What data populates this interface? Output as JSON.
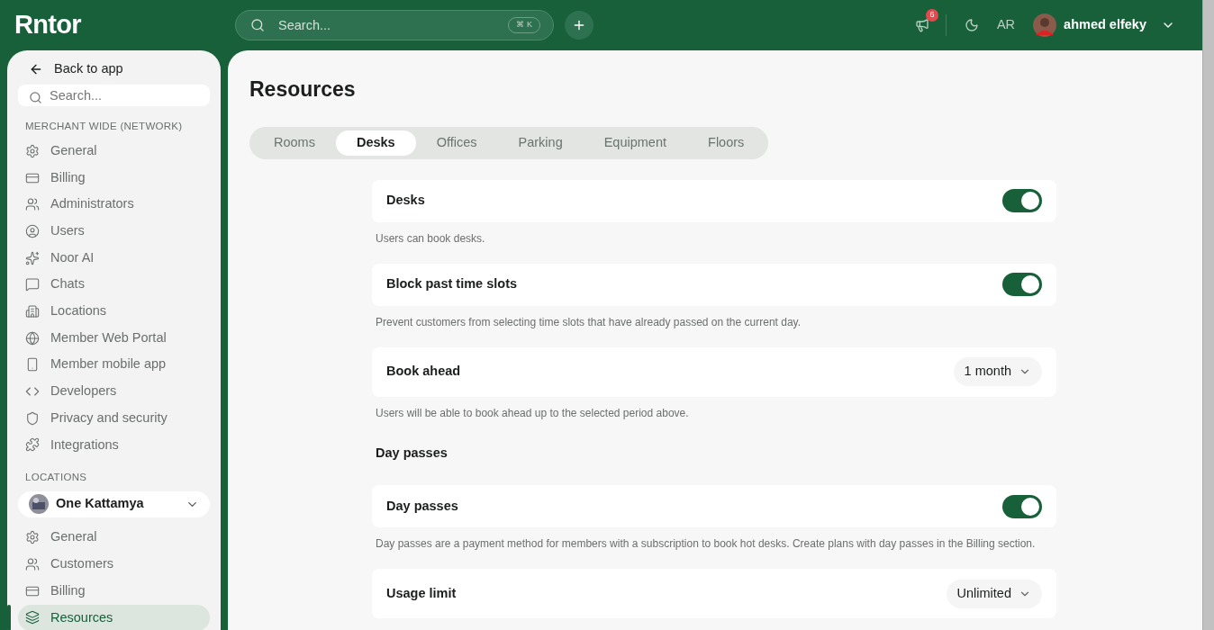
{
  "header": {
    "logo": "Rntor",
    "search": {
      "placeholder": "Search...",
      "shortcut": "⌘ K"
    },
    "notifications": "6",
    "language": "AR",
    "user": "ahmed elfeky"
  },
  "sidebar": {
    "back": "Back to app",
    "search": {
      "placeholder": "Search..."
    },
    "sections": [
      {
        "title": "MERCHANT WIDE (NETWORK)",
        "items": [
          {
            "label": "General",
            "selected": false
          },
          {
            "label": "Billing",
            "selected": false
          },
          {
            "label": "Administrators",
            "selected": false
          },
          {
            "label": "Users",
            "selected": false
          },
          {
            "label": "Noor AI",
            "selected": false
          },
          {
            "label": "Chats",
            "selected": false
          },
          {
            "label": "Locations",
            "selected": false
          },
          {
            "label": "Member Web Portal",
            "selected": false
          },
          {
            "label": "Member mobile app",
            "selected": false
          },
          {
            "label": "Developers",
            "selected": false
          },
          {
            "label": "Privacy and security",
            "selected": false
          },
          {
            "label": "Integrations",
            "selected": false
          }
        ]
      },
      {
        "title": "LOCATIONS",
        "location": "One Kattamya",
        "items": [
          {
            "label": "General",
            "selected": false
          },
          {
            "label": "Customers",
            "selected": false
          },
          {
            "label": "Billing",
            "selected": false
          },
          {
            "label": "Resources",
            "selected": true
          }
        ]
      }
    ]
  },
  "page": {
    "title": "Resources",
    "tabs": [
      {
        "label": "Rooms",
        "selected": false
      },
      {
        "label": "Desks",
        "selected": true
      },
      {
        "label": "Offices",
        "selected": false
      },
      {
        "label": "Parking",
        "selected": false
      },
      {
        "label": "Equipment",
        "selected": false
      },
      {
        "label": "Floors",
        "selected": false
      }
    ],
    "settings": [
      {
        "kind": "toggle",
        "label": "Desks",
        "on": true,
        "description": "Users can book desks."
      },
      {
        "kind": "toggle",
        "label": "Block past time slots",
        "on": true,
        "description": "Prevent customers from selecting time slots that have already passed on the current day."
      },
      {
        "kind": "select",
        "label": "Book ahead",
        "value": "1 month",
        "description": "Users will be able to book ahead up to the selected period above."
      },
      {
        "kind": "heading",
        "label": "Day passes"
      },
      {
        "kind": "toggle",
        "label": "Day passes",
        "on": true,
        "description": "Day passes are a payment method for members with a subscription to book hot desks. Create plans with day passes in the Billing section."
      },
      {
        "kind": "select",
        "label": "Usage limit",
        "value": "Unlimited"
      }
    ]
  }
}
